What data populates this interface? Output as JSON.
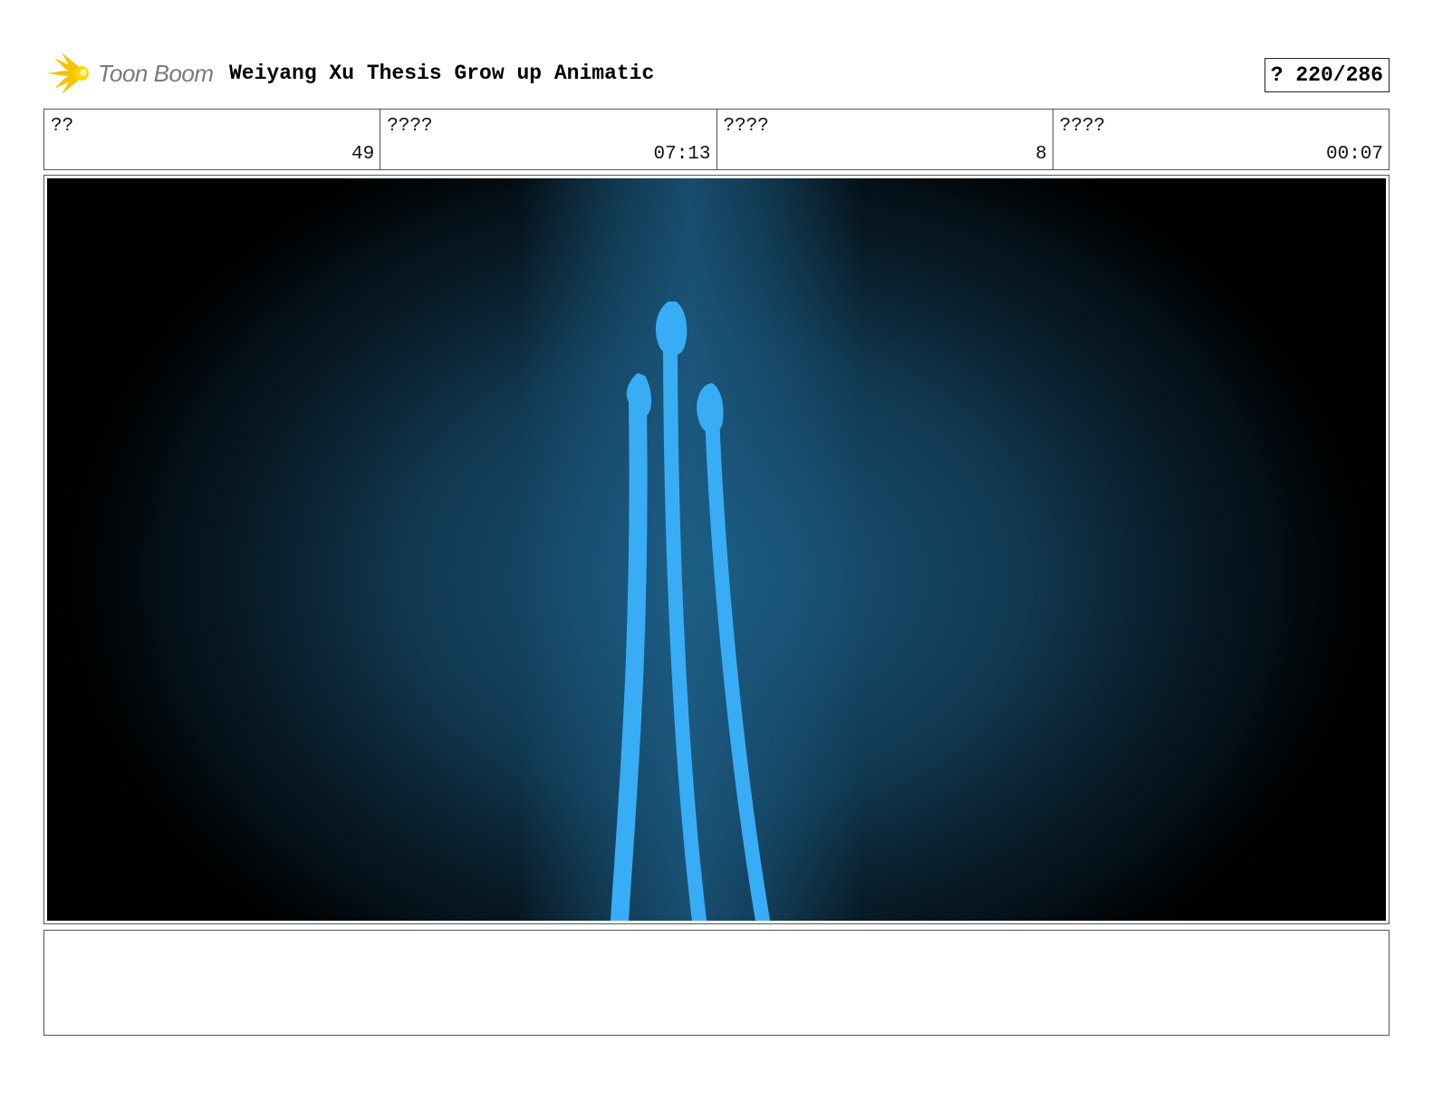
{
  "header": {
    "logo_text": "Toon Boom",
    "title": "Weiyang Xu Thesis Grow up Animatic",
    "page_number": "? 220/286"
  },
  "info": [
    {
      "label": "??",
      "value": "49"
    },
    {
      "label": "????",
      "value": "07:13"
    },
    {
      "label": "????",
      "value": "8"
    },
    {
      "label": "????",
      "value": "00:07"
    }
  ],
  "panel": {
    "background_color": "#000000",
    "glow_color": "#1c5a80",
    "stroke_color": "#38adf5"
  },
  "caption": {
    "text": ""
  },
  "colors": {
    "logo_star": "#f5c400",
    "logo_text": "#7a7a7a",
    "border": "#555555"
  }
}
